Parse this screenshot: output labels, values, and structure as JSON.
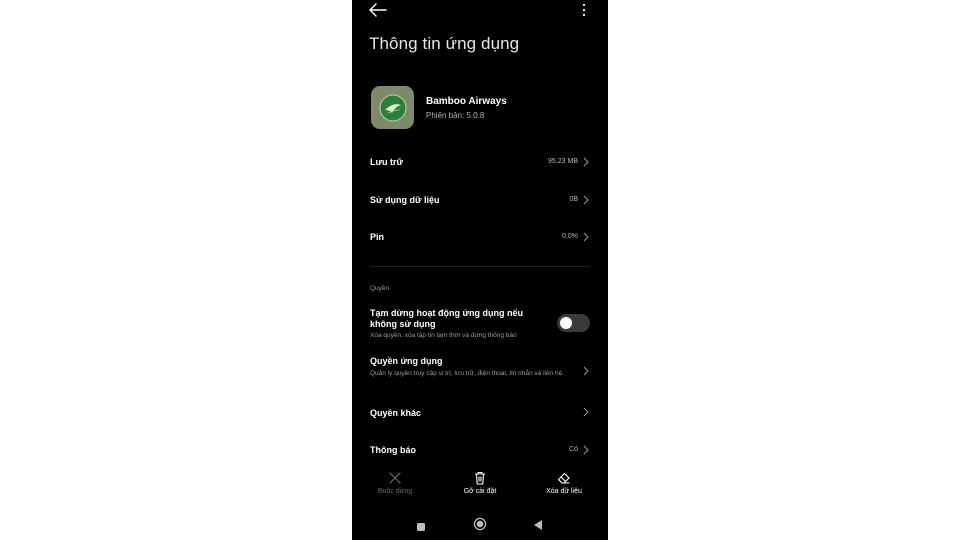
{
  "header": {
    "title": "Thông tin ứng dụng"
  },
  "app": {
    "name": "Bamboo Airways",
    "version": "Phiên bản: 5.0.8",
    "icon_color": "#7d8a6c"
  },
  "rows": [
    {
      "label": "Lưu trữ",
      "value": "95,23 MB"
    },
    {
      "label": "Sử dụng dữ liệu",
      "value": "0B"
    },
    {
      "label": "Pin",
      "value": "0,0%"
    }
  ],
  "permissions": {
    "section_title": "Quyền",
    "pause_toggle": {
      "title": "Tạm dừng hoạt động ứng dụng nếu không sử dụng",
      "subtitle": "Xóa quyền, xóa tập tin tạm thời và dừng thông báo",
      "enabled": false
    },
    "app_permissions": {
      "title": "Quyền ứng dụng",
      "subtitle": "Quản lý quyền truy cập vị trí, lưu trữ, điện thoại, tin nhắn và liên hệ."
    },
    "other_permissions": {
      "label": "Quyền khác"
    },
    "notifications": {
      "label": "Thông báo",
      "value": "Có"
    }
  },
  "actions": {
    "force_stop": "Buộc dừng",
    "uninstall": "Gỡ cài đặt",
    "clear_data": "Xóa dữ liệu"
  },
  "colors": {
    "background": "#000000",
    "toggle_off": "#3a3a3a",
    "disabled_text": "#6b6b6b"
  }
}
